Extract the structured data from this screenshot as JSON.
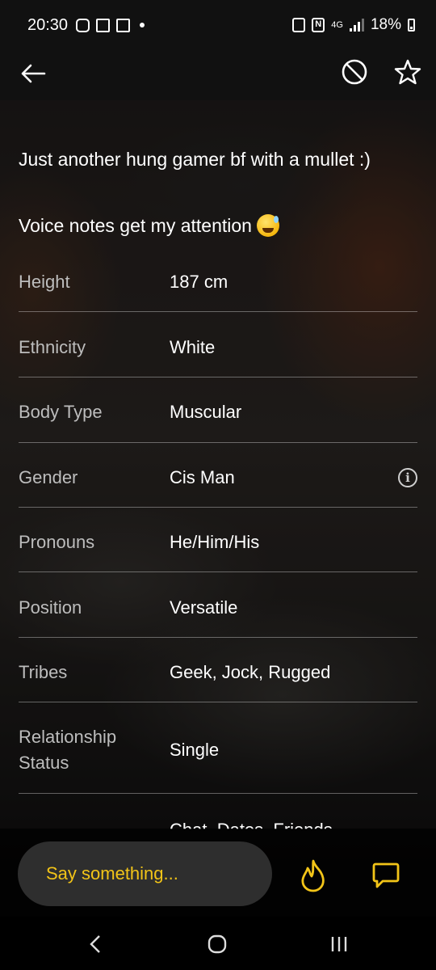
{
  "status_bar": {
    "time": "20:30",
    "network": "4G",
    "battery": "18%"
  },
  "app_bar": {
    "icons": [
      "back-arrow-icon",
      "block-icon",
      "star-icon"
    ]
  },
  "profile": {
    "bio_line_1": "Just another hung gamer bf with a mullet :)",
    "bio_line_2": "Voice notes get my attention",
    "attributes": [
      {
        "label": "Height",
        "value": "187 cm"
      },
      {
        "label": "Ethnicity",
        "value": "White"
      },
      {
        "label": "Body Type",
        "value": "Muscular"
      },
      {
        "label": "Gender",
        "value": "Cis Man"
      },
      {
        "label": "Pronouns",
        "value": "He/Him/His"
      },
      {
        "label": "Position",
        "value": "Versatile"
      },
      {
        "label": "Tribes",
        "value": "Geek, Jock, Rugged"
      },
      {
        "label": "Relationship Status",
        "value": "Single"
      }
    ],
    "partial_value": "Chat, Dates, Friends"
  },
  "chat": {
    "placeholder": "Say something..."
  },
  "colors": {
    "accent": "#f2c418",
    "bar_bg": "#111111",
    "input_bg": "#2e2e2e"
  }
}
